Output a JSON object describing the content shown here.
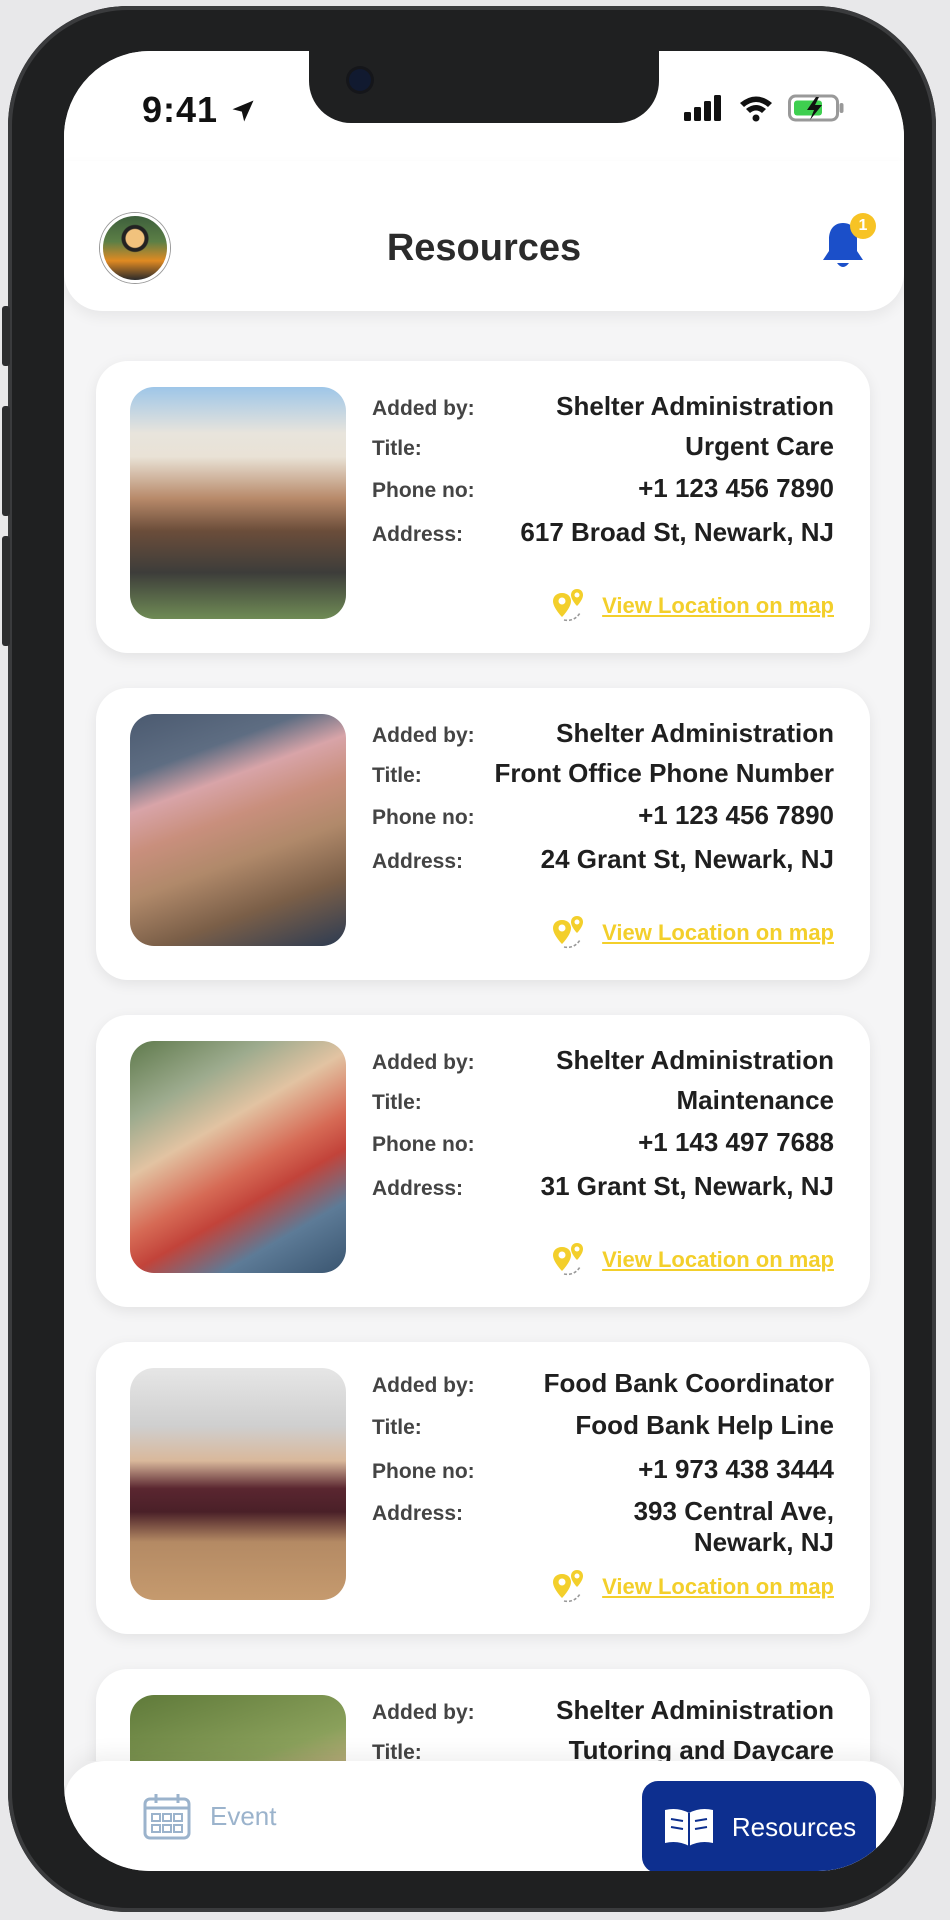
{
  "status_bar": {
    "time": "9:41"
  },
  "header": {
    "title": "Resources",
    "notification_count": "1"
  },
  "labels": {
    "added_by": "Added by:",
    "title": "Title:",
    "phone": "Phone no:",
    "address": "Address:",
    "view_map": "View Location on map"
  },
  "resources": [
    {
      "added_by": "Shelter Administration",
      "title": "Urgent Care",
      "phone": "+1 123 456 7890",
      "address": "617 Broad St, Newark, NJ"
    },
    {
      "added_by": "Shelter Administration",
      "title": "Front Office Phone Number",
      "phone": "+1 123 456 7890",
      "address": "24 Grant St, Newark, NJ"
    },
    {
      "added_by": "Shelter Administration",
      "title": "Maintenance",
      "phone": "+1 143 497 7688",
      "address": "31 Grant St, Newark, NJ"
    },
    {
      "added_by": "Food Bank Coordinator",
      "title": "Food Bank Help Line",
      "phone": "+1 973 438 3444",
      "address_line1": "393 Central Ave,",
      "address_line2": "Newark, NJ"
    },
    {
      "added_by": "Shelter Administration",
      "title": "Tutoring and Daycare"
    }
  ],
  "bottom_nav": {
    "event_label": "Event",
    "resources_label": "Resources"
  },
  "colors": {
    "accent_yellow": "#f3cf2b",
    "nav_active": "#0d2f8f",
    "bell_blue": "#1b4fc9",
    "badge_yellow": "#f7c325"
  }
}
